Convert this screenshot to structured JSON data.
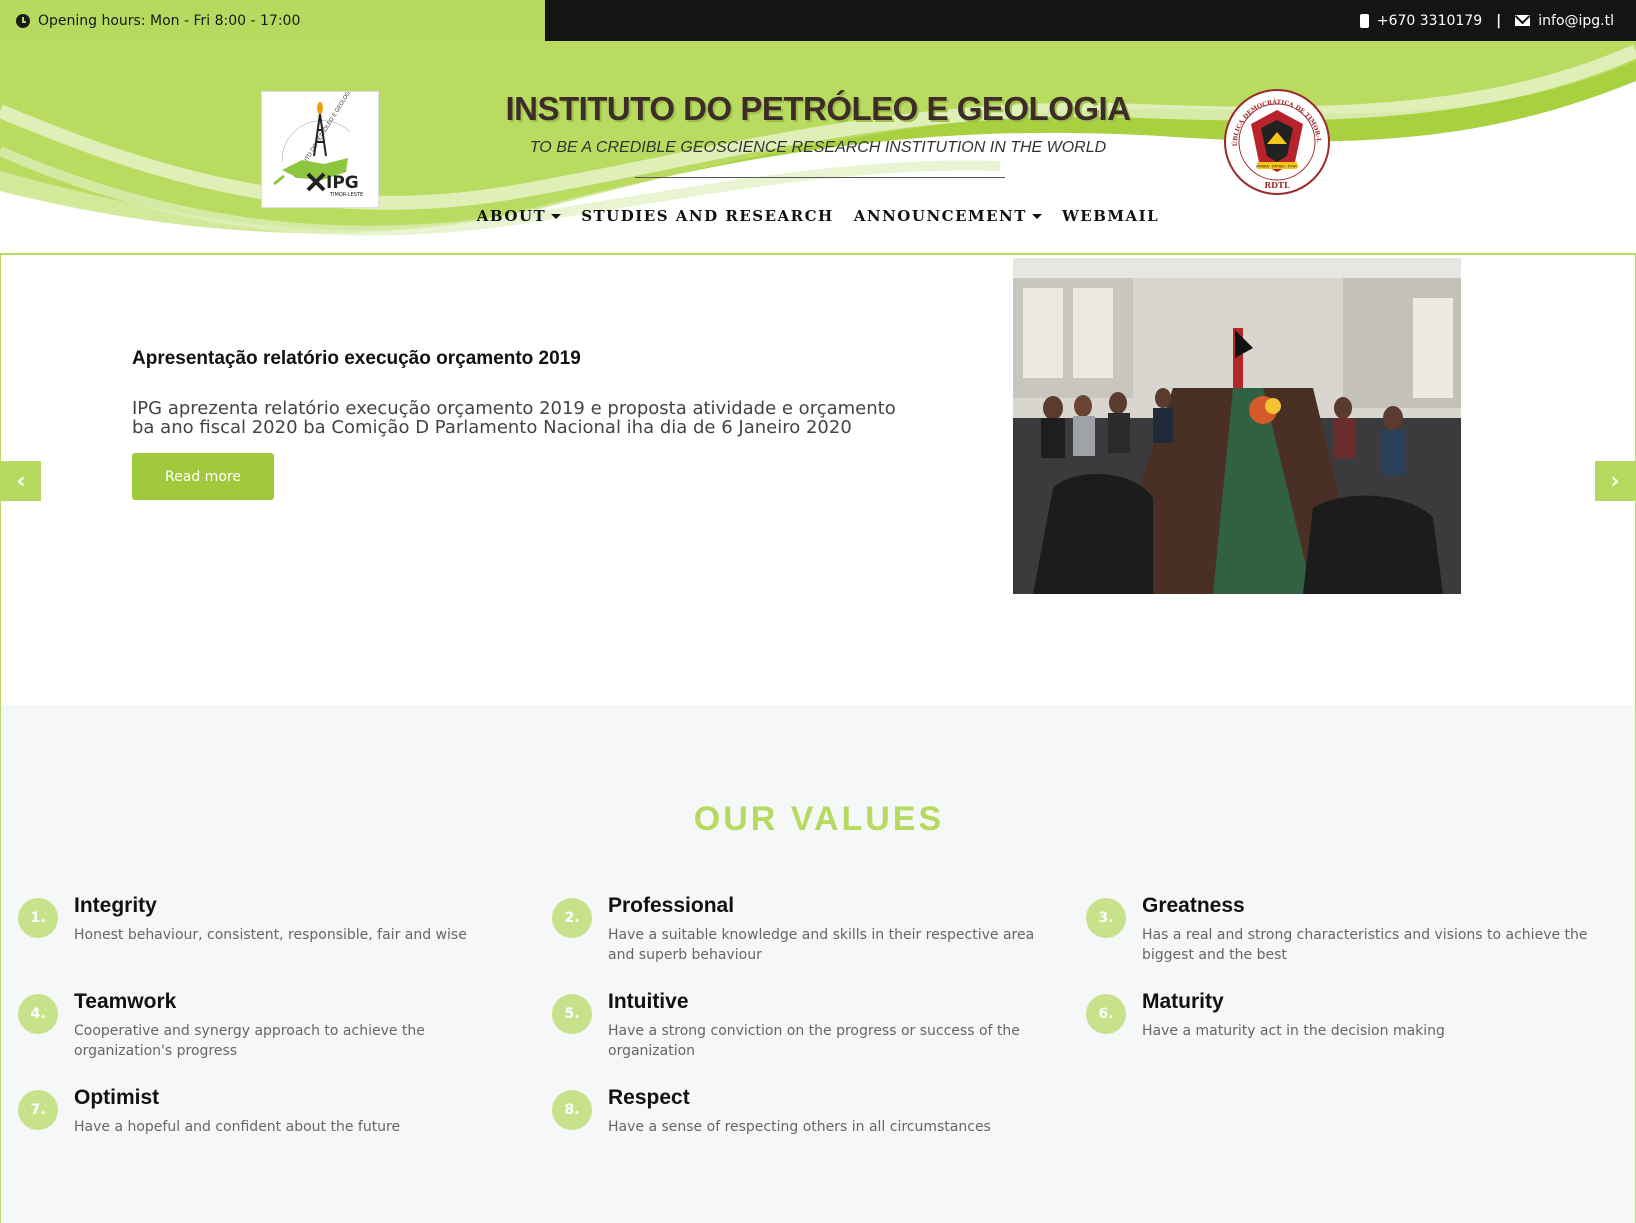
{
  "topbar": {
    "hours": "Opening hours: Mon - Fri 8:00 - 17:00",
    "phone": "+670 3310179",
    "separator": "|",
    "email": "info@ipg.tl"
  },
  "header": {
    "title": "INSTITUTO DO PETRÓLEO E GEOLOGIA",
    "tagline": "TO BE A CREDIBLE GEOSCIENCE RESEARCH INSTITUTION IN THE WORLD",
    "logo": {
      "arc_text": "INSTITUTO DO PETRÓLEO E GEOLOGIA",
      "mark": "IPG",
      "sub": "TIMOR-LESTE"
    },
    "emblem": {
      "ring_text": "REPÚBLICA DEMOCRÁTICA DE TIMOR-LESTE",
      "banner": "HONRA · PÁTRIA · POVO",
      "initials": "RDTL"
    }
  },
  "nav": {
    "items": [
      {
        "label": "ABOUT",
        "dropdown": true
      },
      {
        "label": "STUDIES AND RESEARCH",
        "dropdown": false
      },
      {
        "label": "ANNOUNCEMENT",
        "dropdown": true
      },
      {
        "label": "WEBMAIL",
        "dropdown": false
      }
    ]
  },
  "slider": {
    "title": "Apresentação relatório execução orçamento 2019",
    "text": "IPG aprezenta relatório execução orçamento 2019 e proposta atividade e orçamento ba ano fiscal 2020 ba Comição D Parlamento Nacional iha dia de 6 Janeiro 2020",
    "button": "Read more",
    "prev_icon": "chevron-left-icon",
    "next_icon": "chevron-right-icon"
  },
  "values": {
    "heading": "OUR VALUES",
    "items": [
      {
        "num": "1.",
        "name": "Integrity",
        "desc": "Honest behaviour, consistent, responsible, fair and wise"
      },
      {
        "num": "2.",
        "name": "Professional",
        "desc": "Have a suitable knowledge and skills in their respective area and superb behaviour"
      },
      {
        "num": "3.",
        "name": "Greatness",
        "desc": "Has a real and strong characteristics and visions to achieve the biggest and the best"
      },
      {
        "num": "4.",
        "name": "Teamwork",
        "desc": "Cooperative and synergy approach to achieve the organization's progress"
      },
      {
        "num": "5.",
        "name": "Intuitive",
        "desc": "Have a strong conviction on the progress or success of the organization"
      },
      {
        "num": "6.",
        "name": "Maturity",
        "desc": "Have a maturity act in the decision making"
      },
      {
        "num": "7.",
        "name": "Optimist",
        "desc": "Have a hopeful and confident about the future"
      },
      {
        "num": "8.",
        "name": "Respect",
        "desc": "Have a sense of respecting others in all circumstances"
      }
    ]
  },
  "colors": {
    "accent": "#b5da5f",
    "button": "#a0c93b",
    "dark": "#141414",
    "title": "#3d2c27"
  }
}
